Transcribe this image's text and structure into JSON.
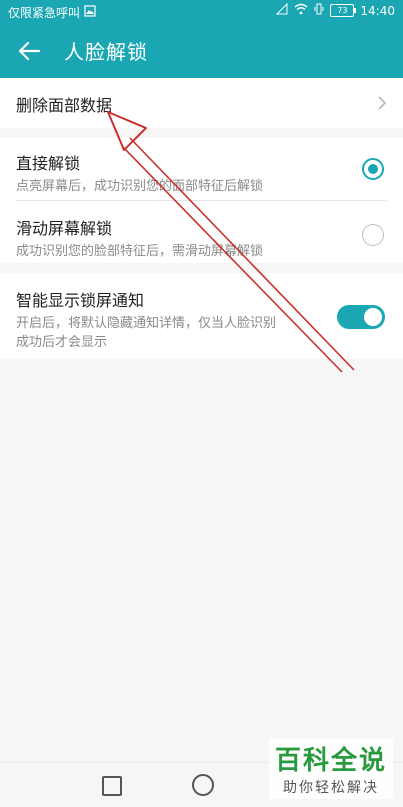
{
  "status_bar": {
    "carrier_text": "仅限紧急呼叫",
    "battery_level": "73",
    "time": "14:40"
  },
  "app_bar": {
    "title": "人脸解锁"
  },
  "sections": {
    "delete": {
      "label": "删除面部数据"
    },
    "unlock_modes": {
      "direct": {
        "title": "直接解锁",
        "subtitle": "点亮屏幕后，成功识别您的面部特征后解锁",
        "selected": true
      },
      "swipe": {
        "title": "滑动屏幕解锁",
        "subtitle": "成功识别您的脸部特征后，需滑动屏幕解锁",
        "selected": false
      }
    },
    "notifications": {
      "title": "智能显示锁屏通知",
      "subtitle_line1": "开启后，将默认隐藏通知详情，仅当人脸识别",
      "subtitle_line2": "成功后才会显示",
      "enabled": true
    }
  },
  "watermark": {
    "main": "百科全说",
    "sub": "助你轻松解决"
  },
  "colors": {
    "accent": "#1aa7b3",
    "annotation_arrow": "#c8312d"
  }
}
